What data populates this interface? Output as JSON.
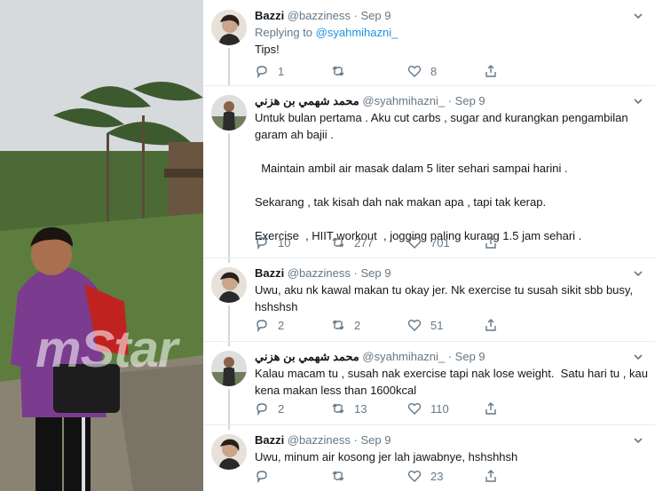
{
  "watermark": "mStar",
  "colors": {
    "link": "#1b95e0",
    "muted": "#657786",
    "text": "#14171a",
    "divider": "#e6ecf0"
  },
  "tweets": [
    {
      "name": "Bazzi",
      "handle": "@bazziness",
      "dot": "·",
      "date": "Sep 9",
      "reply_prefix": "Replying to",
      "reply_handle": "@syahmihazni_",
      "lines": [
        "Tips!"
      ],
      "reply_count": "1",
      "retweet_count": "",
      "like_count": "8"
    },
    {
      "name": "محمد شهمي بن هزني",
      "handle": "@syahmihazni_",
      "dot": "·",
      "date": "Sep 9",
      "lines": [
        "Untuk bulan pertama . Aku cut carbs , sugar and kurangkan pengambilan",
        "garam ah bajii .",
        "",
        "  Maintain ambil air masak dalam 5 liter sehari sampai harini .",
        "",
        "Sekarang , tak kisah dah nak makan apa , tapi tak kerap.",
        "",
        "Exercise  , HIIT workout  , jogging paling kurang 1.5 jam sehari ."
      ],
      "reply_count": "10",
      "retweet_count": "277",
      "like_count": "701"
    },
    {
      "name": "Bazzi",
      "handle": "@bazziness",
      "dot": "·",
      "date": "Sep 9",
      "lines": [
        "Uwu, aku nk kawal makan tu okay jer. Nk exercise tu susah sikit sbb busy,",
        "hshshsh"
      ],
      "reply_count": "2",
      "retweet_count": "2",
      "like_count": "51"
    },
    {
      "name": "محمد شهمي بن هزني",
      "handle": "@syahmihazni_",
      "dot": "·",
      "date": "Sep 9",
      "lines": [
        "Kalau macam tu , susah nak exercise tapi nak lose weight.  Satu hari tu , kau",
        "kena makan less than 1600kcal"
      ],
      "reply_count": "2",
      "retweet_count": "13",
      "like_count": "110"
    },
    {
      "name": "Bazzi",
      "handle": "@bazziness",
      "dot": "·",
      "date": "Sep 9",
      "lines": [
        "Uwu, minum air kosong jer lah jawabnye, hshshhsh"
      ],
      "reply_count": "",
      "retweet_count": "",
      "like_count": "23"
    }
  ]
}
